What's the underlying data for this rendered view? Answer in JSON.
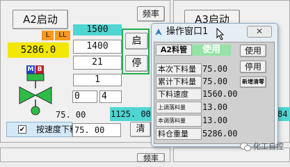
{
  "left": {
    "title": "A2启动",
    "freq_button": "频率",
    "badge_l": "L",
    "badge_ll": "LL",
    "weight": "5286.0",
    "m_icon": "M",
    "b_icon": "B",
    "values": [
      "1500",
      "1400",
      "21",
      "1",
      "0",
      "4"
    ],
    "bottom_value": "75. 00",
    "mid_value": "1125. 00",
    "checkbox_label": "按速度下料",
    "speed_value": "75. 00",
    "clear_button": "清"
  },
  "middle": {
    "start_button": "启",
    "stop_button": "停",
    "bottom_button": "频率"
  },
  "right": {
    "title": "A3启动",
    "side_value": "84"
  },
  "dialog": {
    "title": "操作窗口1",
    "pipe_label": "A2料管",
    "pipe_status": "使用",
    "btn_use": "使用",
    "btn_stop": "停用",
    "btn_record": "新增清零",
    "rows": [
      {
        "label": "本次下料量",
        "value": "75.00"
      },
      {
        "label": "累计下料量",
        "value": "75.00"
      },
      {
        "label": "下料速度",
        "value": "1560.00"
      },
      {
        "label": "上调落料量",
        "value": "13.00"
      },
      {
        "label": "本调落料量",
        "value": "13.00"
      },
      {
        "label": "料仓重量",
        "value": "5286.00"
      }
    ]
  },
  "watermark": "化工自控"
}
